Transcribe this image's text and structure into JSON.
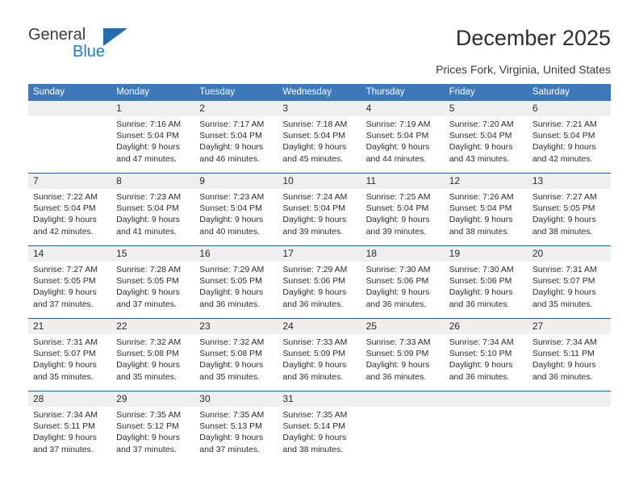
{
  "logo": {
    "word_one": "General",
    "word_two": "Blue",
    "triangle_color": "#1f6cb0",
    "blue_text_color": "#1b7fd4"
  },
  "header": {
    "title": "December 2025",
    "subtitle": "Prices Fork, Virginia, United States",
    "accent_color": "#3d79ba",
    "row_band_color": "#efefef",
    "week_rule_color": "#2a6099"
  },
  "calendar": {
    "day_names": [
      "Sunday",
      "Monday",
      "Tuesday",
      "Wednesday",
      "Thursday",
      "Friday",
      "Saturday"
    ],
    "weeks": [
      [
        {
          "day": "",
          "sunrise": "",
          "sunset": "",
          "daylight_line1": "",
          "daylight_line2": ""
        },
        {
          "day": "1",
          "sunrise": "Sunrise: 7:16 AM",
          "sunset": "Sunset: 5:04 PM",
          "daylight_line1": "Daylight: 9 hours",
          "daylight_line2": "and 47 minutes."
        },
        {
          "day": "2",
          "sunrise": "Sunrise: 7:17 AM",
          "sunset": "Sunset: 5:04 PM",
          "daylight_line1": "Daylight: 9 hours",
          "daylight_line2": "and 46 minutes."
        },
        {
          "day": "3",
          "sunrise": "Sunrise: 7:18 AM",
          "sunset": "Sunset: 5:04 PM",
          "daylight_line1": "Daylight: 9 hours",
          "daylight_line2": "and 45 minutes."
        },
        {
          "day": "4",
          "sunrise": "Sunrise: 7:19 AM",
          "sunset": "Sunset: 5:04 PM",
          "daylight_line1": "Daylight: 9 hours",
          "daylight_line2": "and 44 minutes."
        },
        {
          "day": "5",
          "sunrise": "Sunrise: 7:20 AM",
          "sunset": "Sunset: 5:04 PM",
          "daylight_line1": "Daylight: 9 hours",
          "daylight_line2": "and 43 minutes."
        },
        {
          "day": "6",
          "sunrise": "Sunrise: 7:21 AM",
          "sunset": "Sunset: 5:04 PM",
          "daylight_line1": "Daylight: 9 hours",
          "daylight_line2": "and 42 minutes."
        }
      ],
      [
        {
          "day": "7",
          "sunrise": "Sunrise: 7:22 AM",
          "sunset": "Sunset: 5:04 PM",
          "daylight_line1": "Daylight: 9 hours",
          "daylight_line2": "and 42 minutes."
        },
        {
          "day": "8",
          "sunrise": "Sunrise: 7:23 AM",
          "sunset": "Sunset: 5:04 PM",
          "daylight_line1": "Daylight: 9 hours",
          "daylight_line2": "and 41 minutes."
        },
        {
          "day": "9",
          "sunrise": "Sunrise: 7:23 AM",
          "sunset": "Sunset: 5:04 PM",
          "daylight_line1": "Daylight: 9 hours",
          "daylight_line2": "and 40 minutes."
        },
        {
          "day": "10",
          "sunrise": "Sunrise: 7:24 AM",
          "sunset": "Sunset: 5:04 PM",
          "daylight_line1": "Daylight: 9 hours",
          "daylight_line2": "and 39 minutes."
        },
        {
          "day": "11",
          "sunrise": "Sunrise: 7:25 AM",
          "sunset": "Sunset: 5:04 PM",
          "daylight_line1": "Daylight: 9 hours",
          "daylight_line2": "and 39 minutes."
        },
        {
          "day": "12",
          "sunrise": "Sunrise: 7:26 AM",
          "sunset": "Sunset: 5:04 PM",
          "daylight_line1": "Daylight: 9 hours",
          "daylight_line2": "and 38 minutes."
        },
        {
          "day": "13",
          "sunrise": "Sunrise: 7:27 AM",
          "sunset": "Sunset: 5:05 PM",
          "daylight_line1": "Daylight: 9 hours",
          "daylight_line2": "and 38 minutes."
        }
      ],
      [
        {
          "day": "14",
          "sunrise": "Sunrise: 7:27 AM",
          "sunset": "Sunset: 5:05 PM",
          "daylight_line1": "Daylight: 9 hours",
          "daylight_line2": "and 37 minutes."
        },
        {
          "day": "15",
          "sunrise": "Sunrise: 7:28 AM",
          "sunset": "Sunset: 5:05 PM",
          "daylight_line1": "Daylight: 9 hours",
          "daylight_line2": "and 37 minutes."
        },
        {
          "day": "16",
          "sunrise": "Sunrise: 7:29 AM",
          "sunset": "Sunset: 5:05 PM",
          "daylight_line1": "Daylight: 9 hours",
          "daylight_line2": "and 36 minutes."
        },
        {
          "day": "17",
          "sunrise": "Sunrise: 7:29 AM",
          "sunset": "Sunset: 5:06 PM",
          "daylight_line1": "Daylight: 9 hours",
          "daylight_line2": "and 36 minutes."
        },
        {
          "day": "18",
          "sunrise": "Sunrise: 7:30 AM",
          "sunset": "Sunset: 5:06 PM",
          "daylight_line1": "Daylight: 9 hours",
          "daylight_line2": "and 36 minutes."
        },
        {
          "day": "19",
          "sunrise": "Sunrise: 7:30 AM",
          "sunset": "Sunset: 5:06 PM",
          "daylight_line1": "Daylight: 9 hours",
          "daylight_line2": "and 36 minutes."
        },
        {
          "day": "20",
          "sunrise": "Sunrise: 7:31 AM",
          "sunset": "Sunset: 5:07 PM",
          "daylight_line1": "Daylight: 9 hours",
          "daylight_line2": "and 35 minutes."
        }
      ],
      [
        {
          "day": "21",
          "sunrise": "Sunrise: 7:31 AM",
          "sunset": "Sunset: 5:07 PM",
          "daylight_line1": "Daylight: 9 hours",
          "daylight_line2": "and 35 minutes."
        },
        {
          "day": "22",
          "sunrise": "Sunrise: 7:32 AM",
          "sunset": "Sunset: 5:08 PM",
          "daylight_line1": "Daylight: 9 hours",
          "daylight_line2": "and 35 minutes."
        },
        {
          "day": "23",
          "sunrise": "Sunrise: 7:32 AM",
          "sunset": "Sunset: 5:08 PM",
          "daylight_line1": "Daylight: 9 hours",
          "daylight_line2": "and 35 minutes."
        },
        {
          "day": "24",
          "sunrise": "Sunrise: 7:33 AM",
          "sunset": "Sunset: 5:09 PM",
          "daylight_line1": "Daylight: 9 hours",
          "daylight_line2": "and 36 minutes."
        },
        {
          "day": "25",
          "sunrise": "Sunrise: 7:33 AM",
          "sunset": "Sunset: 5:09 PM",
          "daylight_line1": "Daylight: 9 hours",
          "daylight_line2": "and 36 minutes."
        },
        {
          "day": "26",
          "sunrise": "Sunrise: 7:34 AM",
          "sunset": "Sunset: 5:10 PM",
          "daylight_line1": "Daylight: 9 hours",
          "daylight_line2": "and 36 minutes."
        },
        {
          "day": "27",
          "sunrise": "Sunrise: 7:34 AM",
          "sunset": "Sunset: 5:11 PM",
          "daylight_line1": "Daylight: 9 hours",
          "daylight_line2": "and 36 minutes."
        }
      ],
      [
        {
          "day": "28",
          "sunrise": "Sunrise: 7:34 AM",
          "sunset": "Sunset: 5:11 PM",
          "daylight_line1": "Daylight: 9 hours",
          "daylight_line2": "and 37 minutes."
        },
        {
          "day": "29",
          "sunrise": "Sunrise: 7:35 AM",
          "sunset": "Sunset: 5:12 PM",
          "daylight_line1": "Daylight: 9 hours",
          "daylight_line2": "and 37 minutes."
        },
        {
          "day": "30",
          "sunrise": "Sunrise: 7:35 AM",
          "sunset": "Sunset: 5:13 PM",
          "daylight_line1": "Daylight: 9 hours",
          "daylight_line2": "and 37 minutes."
        },
        {
          "day": "31",
          "sunrise": "Sunrise: 7:35 AM",
          "sunset": "Sunset: 5:14 PM",
          "daylight_line1": "Daylight: 9 hours",
          "daylight_line2": "and 38 minutes."
        },
        {
          "day": "",
          "sunrise": "",
          "sunset": "",
          "daylight_line1": "",
          "daylight_line2": ""
        },
        {
          "day": "",
          "sunrise": "",
          "sunset": "",
          "daylight_line1": "",
          "daylight_line2": ""
        },
        {
          "day": "",
          "sunrise": "",
          "sunset": "",
          "daylight_line1": "",
          "daylight_line2": ""
        }
      ]
    ]
  }
}
